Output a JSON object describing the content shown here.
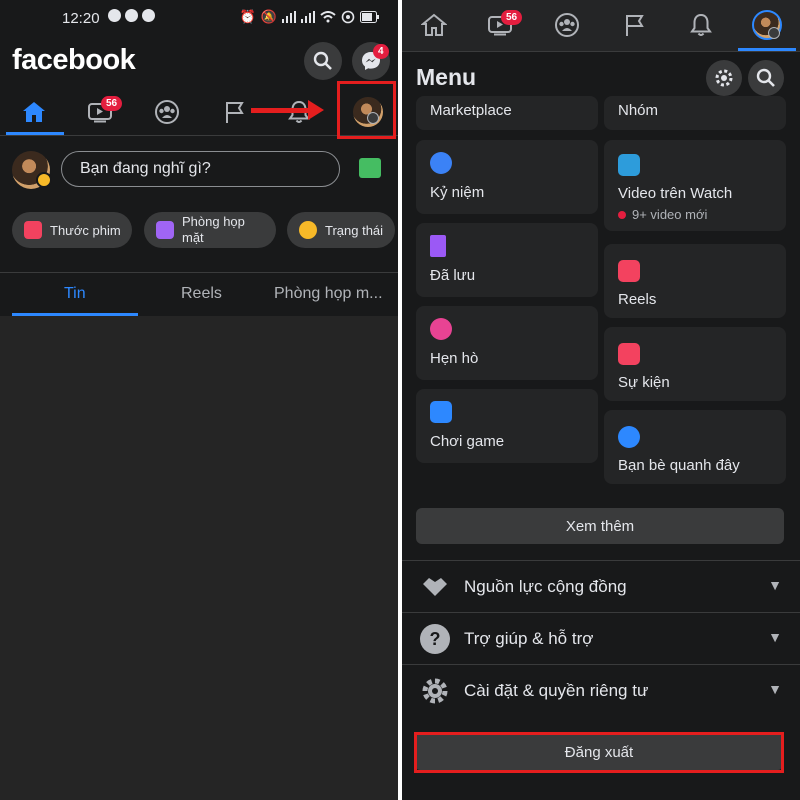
{
  "left": {
    "status": {
      "time": "12:20"
    },
    "app_name": "facebook",
    "messenger_badge": "4",
    "watch_badge": "56",
    "composer_placeholder": "Bạn đang nghĩ gì?",
    "chips": [
      {
        "label": "Thước phim",
        "icon": "reels-icon",
        "color": "#f3425f"
      },
      {
        "label": "Phòng họp mặt",
        "icon": "video-room-icon",
        "color": "#a065f5"
      },
      {
        "label": "Trạng thái",
        "icon": "smile-icon",
        "color": "#f7b928"
      }
    ],
    "tabs": [
      "Tin",
      "Reels",
      "Phòng họp m..."
    ]
  },
  "right": {
    "watch_badge": "56",
    "menu_title": "Menu",
    "cards_left": [
      {
        "label": "Marketplace",
        "icon": ""
      },
      {
        "label": "Kỷ niệm",
        "icon": "clock-icon",
        "color": "#3b82f6"
      },
      {
        "label": "Đã lưu",
        "icon": "bookmark-icon",
        "color": "#9b59f5"
      },
      {
        "label": "Hẹn hò",
        "icon": "heart-icon",
        "color": "#e84393"
      },
      {
        "label": "Chơi game",
        "icon": "gaming-icon",
        "color": "#2d88ff"
      }
    ],
    "cards_right": [
      {
        "label": "Nhóm",
        "icon": ""
      },
      {
        "label": "Video trên Watch",
        "sub": "9+ video mới",
        "icon": "watch-icon",
        "color": "#2d9cdb"
      },
      {
        "label": "Reels",
        "icon": "reels-icon",
        "color": "#f3425f"
      },
      {
        "label": "Sự kiện",
        "icon": "calendar-icon",
        "color": "#f3425f"
      },
      {
        "label": "Bạn bè quanh đây",
        "icon": "location-icon",
        "color": "#2d88ff"
      }
    ],
    "see_more": "Xem thêm",
    "sections": [
      {
        "label": "Nguồn lực cộng đồng",
        "icon": "handshake-icon"
      },
      {
        "label": "Trợ giúp & hỗ trợ",
        "icon": "help-icon"
      },
      {
        "label": "Cài đặt & quyền riêng tư",
        "icon": "gear-icon"
      }
    ],
    "logout": "Đăng xuất"
  },
  "colors": {
    "accent": "#2d88ff",
    "highlight": "#e41e1e",
    "badge": "#e41e3f",
    "background": "#18191a"
  }
}
